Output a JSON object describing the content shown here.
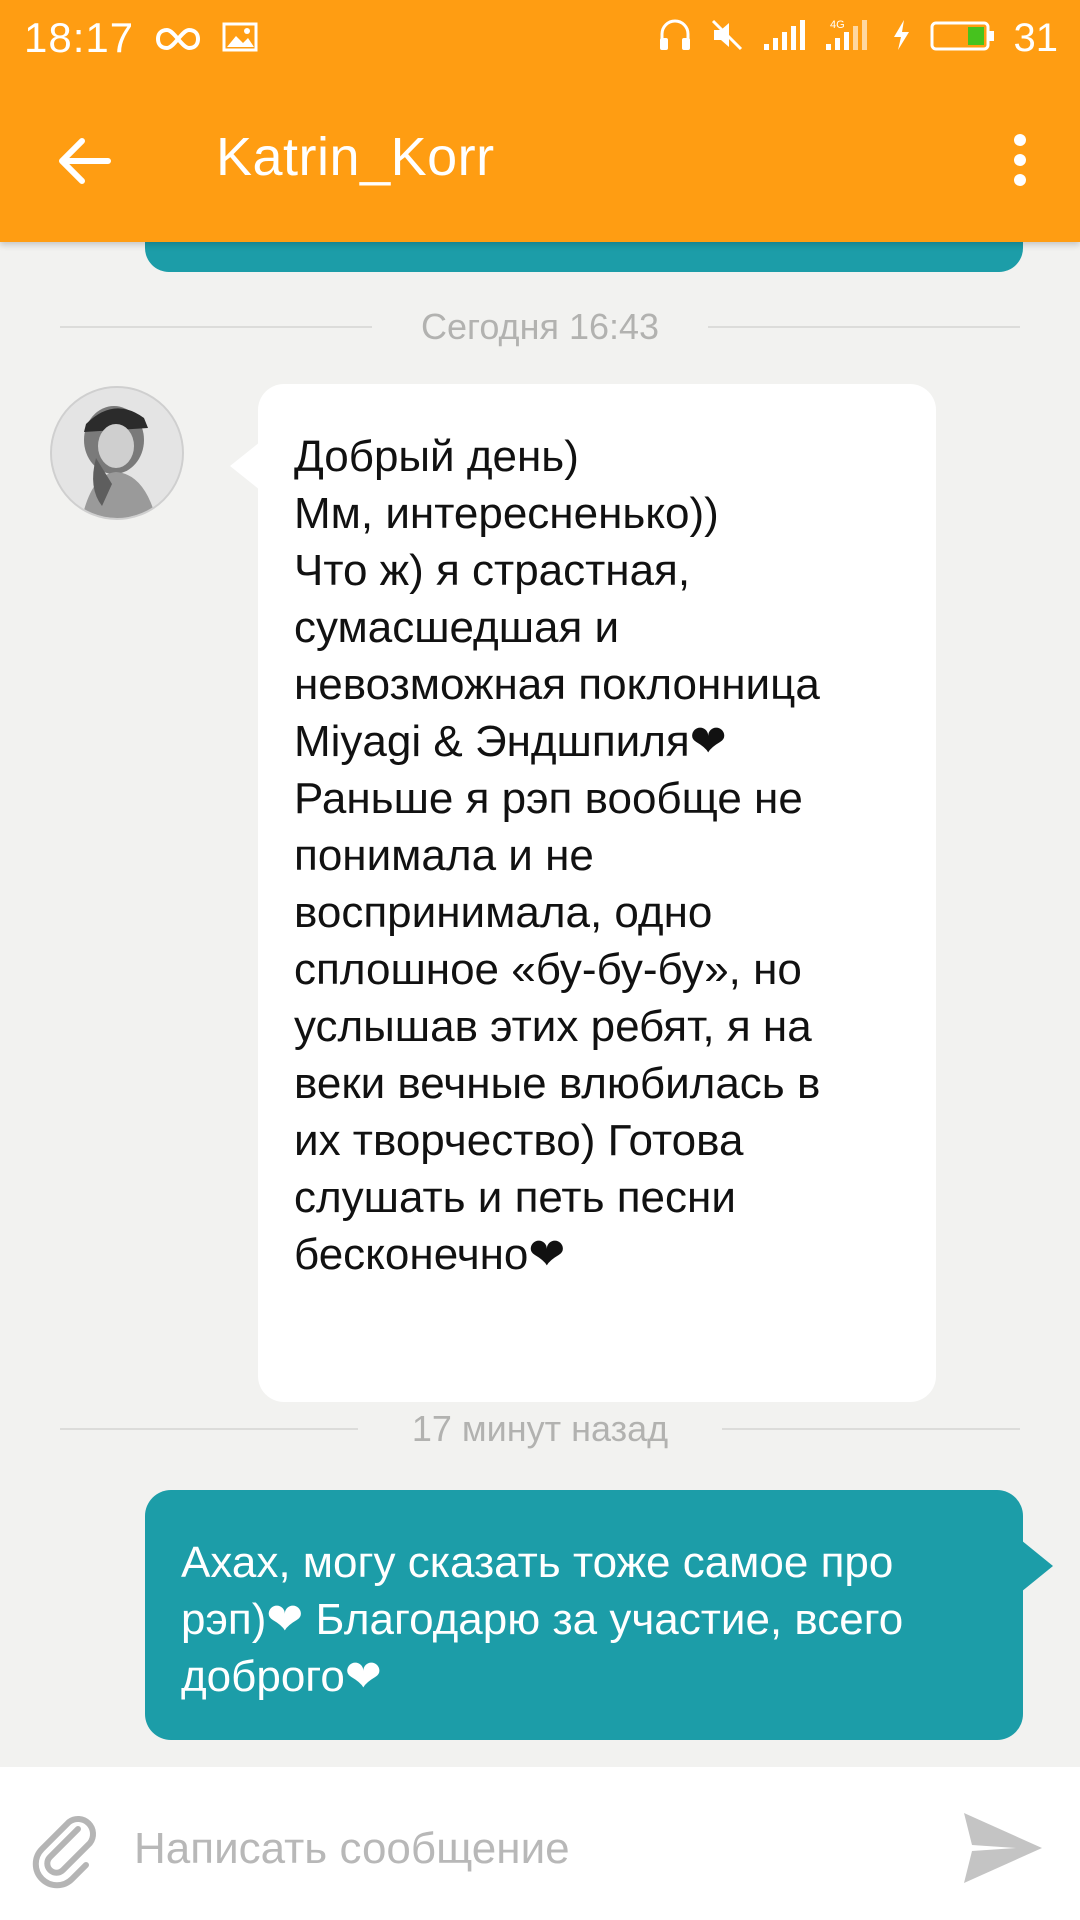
{
  "status_bar": {
    "time": "18:17",
    "battery_level": "31",
    "left_icons": [
      "infinity-icon",
      "image-icon"
    ],
    "right_icons": [
      "headphones-icon",
      "mute-icon",
      "signal-icon",
      "signal-4g-icon",
      "charging-icon",
      "battery-icon"
    ]
  },
  "toolbar": {
    "title": "Katrin_Korr",
    "back_icon": "back-arrow-icon",
    "menu_icon": "more-vertical-icon"
  },
  "messages": {
    "divider_1": "Сегодня 16:43",
    "incoming_text": "Добрый день)\nМм, интересненько))\nЧто ж) я страстная,\nсумасшедшая и\nневозможная поклонница\nMiyagi & Эндшпиля❤\nРаньше я рэп вообще не\nпонимала и не\nвоспринимала, одно\nсплошное «бу-бу-бу», но\nуслышав этих ребят, я на\nвеки вечные влюбилась в\nих творчество) Готова\nслушать и петь песни\nбесконечно❤",
    "divider_2": "17 минут назад",
    "outgoing_text": "Ахах, могу сказать тоже самое про\nрэп)❤ Благодарю за участие, всего\nдоброго❤"
  },
  "compose": {
    "placeholder": "Написать сообщение",
    "attach_icon": "paperclip-icon",
    "send_icon": "send-icon"
  },
  "colors": {
    "header": "#ff9d12",
    "outgoing_bubble": "#1c9da8",
    "incoming_bubble": "#ffffff",
    "background": "#f2f2f0"
  }
}
